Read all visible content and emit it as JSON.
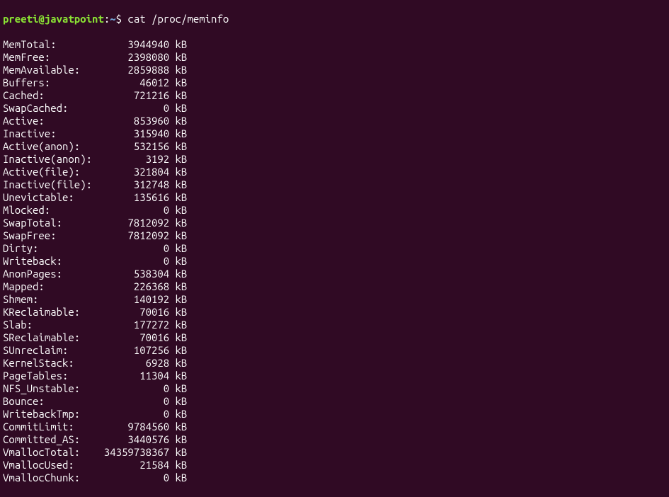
{
  "prompt": {
    "user": "preeti@javatpoint",
    "colon1": ":",
    "tilde": "~",
    "dollar": "$ ",
    "command": "cat /proc/meminfo"
  },
  "meminfo": [
    {
      "key": "MemTotal:",
      "value": "3944940",
      "unit": "kB"
    },
    {
      "key": "MemFree:",
      "value": "2398080",
      "unit": "kB"
    },
    {
      "key": "MemAvailable:",
      "value": "2859888",
      "unit": "kB"
    },
    {
      "key": "Buffers:",
      "value": "46012",
      "unit": "kB"
    },
    {
      "key": "Cached:",
      "value": "721216",
      "unit": "kB"
    },
    {
      "key": "SwapCached:",
      "value": "0",
      "unit": "kB"
    },
    {
      "key": "Active:",
      "value": "853960",
      "unit": "kB"
    },
    {
      "key": "Inactive:",
      "value": "315940",
      "unit": "kB"
    },
    {
      "key": "Active(anon):",
      "value": "532156",
      "unit": "kB"
    },
    {
      "key": "Inactive(anon):",
      "value": "3192",
      "unit": "kB"
    },
    {
      "key": "Active(file):",
      "value": "321804",
      "unit": "kB"
    },
    {
      "key": "Inactive(file):",
      "value": "312748",
      "unit": "kB"
    },
    {
      "key": "Unevictable:",
      "value": "135616",
      "unit": "kB"
    },
    {
      "key": "Mlocked:",
      "value": "0",
      "unit": "kB"
    },
    {
      "key": "SwapTotal:",
      "value": "7812092",
      "unit": "kB"
    },
    {
      "key": "SwapFree:",
      "value": "7812092",
      "unit": "kB"
    },
    {
      "key": "Dirty:",
      "value": "0",
      "unit": "kB"
    },
    {
      "key": "Writeback:",
      "value": "0",
      "unit": "kB"
    },
    {
      "key": "AnonPages:",
      "value": "538304",
      "unit": "kB"
    },
    {
      "key": "Mapped:",
      "value": "226368",
      "unit": "kB"
    },
    {
      "key": "Shmem:",
      "value": "140192",
      "unit": "kB"
    },
    {
      "key": "KReclaimable:",
      "value": "70016",
      "unit": "kB"
    },
    {
      "key": "Slab:",
      "value": "177272",
      "unit": "kB"
    },
    {
      "key": "SReclaimable:",
      "value": "70016",
      "unit": "kB"
    },
    {
      "key": "SUnreclaim:",
      "value": "107256",
      "unit": "kB"
    },
    {
      "key": "KernelStack:",
      "value": "6928",
      "unit": "kB"
    },
    {
      "key": "PageTables:",
      "value": "11304",
      "unit": "kB"
    },
    {
      "key": "NFS_Unstable:",
      "value": "0",
      "unit": "kB"
    },
    {
      "key": "Bounce:",
      "value": "0",
      "unit": "kB"
    },
    {
      "key": "WritebackTmp:",
      "value": "0",
      "unit": "kB"
    },
    {
      "key": "CommitLimit:",
      "value": "9784560",
      "unit": "kB"
    },
    {
      "key": "Committed_AS:",
      "value": "3440576",
      "unit": "kB"
    },
    {
      "key": "VmallocTotal:",
      "value": "34359738367",
      "unit": "kB"
    },
    {
      "key": "VmallocUsed:",
      "value": "21584",
      "unit": "kB"
    },
    {
      "key": "VmallocChunk:",
      "value": "0",
      "unit": "kB"
    }
  ]
}
